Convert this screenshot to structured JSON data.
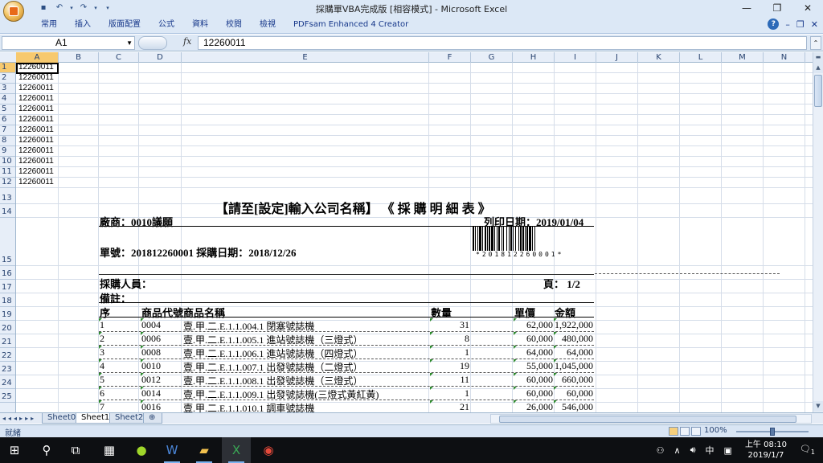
{
  "window": {
    "title": "採購單VBA完成版  [相容模式] - Microsoft Excel"
  },
  "ribbon": {
    "tabs": [
      "常用",
      "插入",
      "版面配置",
      "公式",
      "資料",
      "校閱",
      "檢視",
      "PDFsam Enhanced 4 Creator"
    ]
  },
  "formula_bar": {
    "name_box": "A1",
    "fx": "fx",
    "value": "12260011"
  },
  "columns": [
    "A",
    "B",
    "C",
    "D",
    "E",
    "F",
    "G",
    "H",
    "I",
    "J",
    "K",
    "L",
    "M",
    "N"
  ],
  "rows": [
    "1",
    "2",
    "3",
    "4",
    "5",
    "6",
    "7",
    "8",
    "9",
    "10",
    "11",
    "12",
    "13",
    "14",
    "15",
    "16",
    "17",
    "18",
    "19",
    "20",
    "21",
    "22",
    "23",
    "24",
    "25"
  ],
  "col_a_values": [
    "12260011",
    "12260011",
    "12260011",
    "12260011",
    "12260011",
    "12260011",
    "12260011",
    "12260011",
    "12260011",
    "12260011",
    "12260011",
    "12260011"
  ],
  "document": {
    "title": "【請至[設定]輸入公司名稱】  《 採 購 明 細 表 》",
    "vendor": "廠商：0010議願",
    "print_date": "列印日期：2019/01/04",
    "order": "單號：201812260001   採購日期：2018/12/26",
    "barcode_text": "*201812260001*",
    "buyer": "採購人員：",
    "page": "頁： 1/2",
    "note": "備註：",
    "headers": {
      "seq": "序",
      "code": "商品代號",
      "name": "商品名稱",
      "qty": "數量",
      "price": "單價",
      "amount": "金額"
    },
    "items": [
      {
        "seq": "1",
        "code": "0004",
        "name": "壹.甲.二.E.1.1.004.1  閉塞號誌機",
        "qty": "31",
        "price": "62,000",
        "amount": "1,922,000"
      },
      {
        "seq": "2",
        "code": "0006",
        "name": "壹.甲.二.E.1.1.005.1  進站號誌機（三燈式）",
        "qty": "8",
        "price": "60,000",
        "amount": "480,000"
      },
      {
        "seq": "3",
        "code": "0008",
        "name": "壹.甲.二.E.1.1.006.1  進站號誌機（四燈式）",
        "qty": "1",
        "price": "64,000",
        "amount": "64,000"
      },
      {
        "seq": "4",
        "code": "0010",
        "name": "壹.甲.二.E.1.1.007.1  出發號誌機（二燈式）",
        "qty": "19",
        "price": "55,000",
        "amount": "1,045,000"
      },
      {
        "seq": "5",
        "code": "0012",
        "name": "壹.甲.二.E.1.1.008.1  出發號誌機（三燈式）",
        "qty": "11",
        "price": "60,000",
        "amount": "660,000"
      },
      {
        "seq": "6",
        "code": "0014",
        "name": "壹.甲.二.E.1.1.009.1  出發號誌機(三燈式黃紅黃)",
        "qty": "1",
        "price": "60,000",
        "amount": "60,000"
      },
      {
        "seq": "7",
        "code": "0016",
        "name": "壹.甲.二.E.1.1.010.1  調車號誌機",
        "qty": "21",
        "price": "26,000",
        "amount": "546,000"
      }
    ]
  },
  "sheets": [
    "Sheet0",
    "Sheet1",
    "Sheet2"
  ],
  "active_sheet": "Sheet1",
  "status": {
    "ready": "就緒",
    "zoom": "100%"
  },
  "taskbar": {
    "ime": "中",
    "time": "上午 08:10",
    "date": "2019/1/7",
    "notifications": "1"
  },
  "colors": {
    "chrome": "#dce8f6",
    "selected_header": "#f7c96e",
    "taskbar": "#0d0f12"
  }
}
